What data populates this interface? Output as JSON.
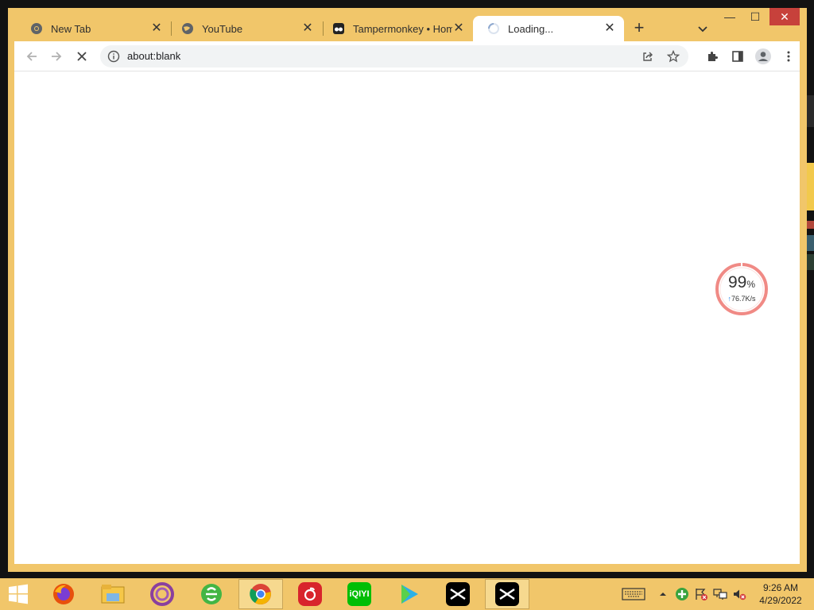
{
  "window": {
    "tabs": [
      {
        "title": "New Tab",
        "icon": "chrome-icon",
        "close": "✕"
      },
      {
        "title": "YouTube",
        "icon": "globe-icon",
        "close": "✕"
      },
      {
        "title": "Tampermonkey • Home",
        "icon": "tampermonkey-icon",
        "close": "✕"
      },
      {
        "title": "Loading...",
        "icon": "loading-spinner-icon",
        "close": "✕",
        "active": true
      }
    ],
    "new_tab_label": "+",
    "controls": {
      "minimize": "—",
      "maximize": "☐",
      "close": "✕"
    },
    "accent_color": "#f1c66a"
  },
  "toolbar": {
    "url": "about:blank",
    "buttons": [
      "back-icon",
      "forward-icon",
      "stop-icon",
      "share-icon",
      "star-icon",
      "extensions-icon",
      "side-panel-icon",
      "profile-icon",
      "menu-icon"
    ]
  },
  "speed_widget": {
    "percent": "99",
    "percent_sign": "%",
    "upload_arrow": "↑",
    "rate": "76.7K/s",
    "ring_color": "#f08a85"
  },
  "taskbar": {
    "apps": [
      "windows-start-icon",
      "firefox-icon",
      "file-explorer-icon",
      "app-purple-icon",
      "ie-green-icon",
      "chrome-icon",
      "netease-music-icon",
      "iqiyi-icon",
      "video-player-icon",
      "capcut-icon",
      "capcut-icon"
    ],
    "iqiyi_label": "iQIYI",
    "clock_time": "9:26 AM",
    "clock_date": "4/29/2022"
  }
}
